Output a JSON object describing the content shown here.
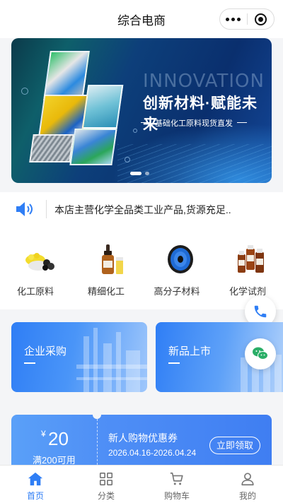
{
  "app": {
    "title": "综合电商"
  },
  "colors": {
    "accent": "#2f7ef5",
    "page_bg": "#f4f5f7"
  },
  "banner": {
    "en_text": "INNOVATION",
    "headline": "创新材料·赋能未来",
    "subline": "基础化工原料现货直发",
    "slide_count": 2,
    "active_slide": 1
  },
  "notice": {
    "icon": "speaker-icon",
    "text": "本店主营化学全品类工业产品,货源充足.."
  },
  "categories": [
    {
      "label": "化工原料",
      "icon": "raw-materials-icon"
    },
    {
      "label": "精细化工",
      "icon": "dropper-bottle-icon"
    },
    {
      "label": "高分子材料",
      "icon": "filament-spool-icon"
    },
    {
      "label": "化学试剂",
      "icon": "reagent-bottles-icon"
    }
  ],
  "promo_cards": [
    {
      "title": "企业采购"
    },
    {
      "title": "新品上市"
    }
  ],
  "floating": {
    "phone_icon": "phone-icon",
    "wechat_icon": "wechat-icon"
  },
  "coupon": {
    "currency": "¥",
    "amount": "20",
    "condition": "满200可用",
    "title": "新人购物优惠券",
    "valid": "2026.04.16-2026.04.24",
    "button": "立即领取"
  },
  "tabbar": [
    {
      "label": "首页",
      "icon": "home-icon",
      "active": true
    },
    {
      "label": "分类",
      "icon": "grid-icon",
      "active": false
    },
    {
      "label": "购物车",
      "icon": "cart-icon",
      "active": false
    },
    {
      "label": "我的",
      "icon": "user-icon",
      "active": false
    }
  ]
}
